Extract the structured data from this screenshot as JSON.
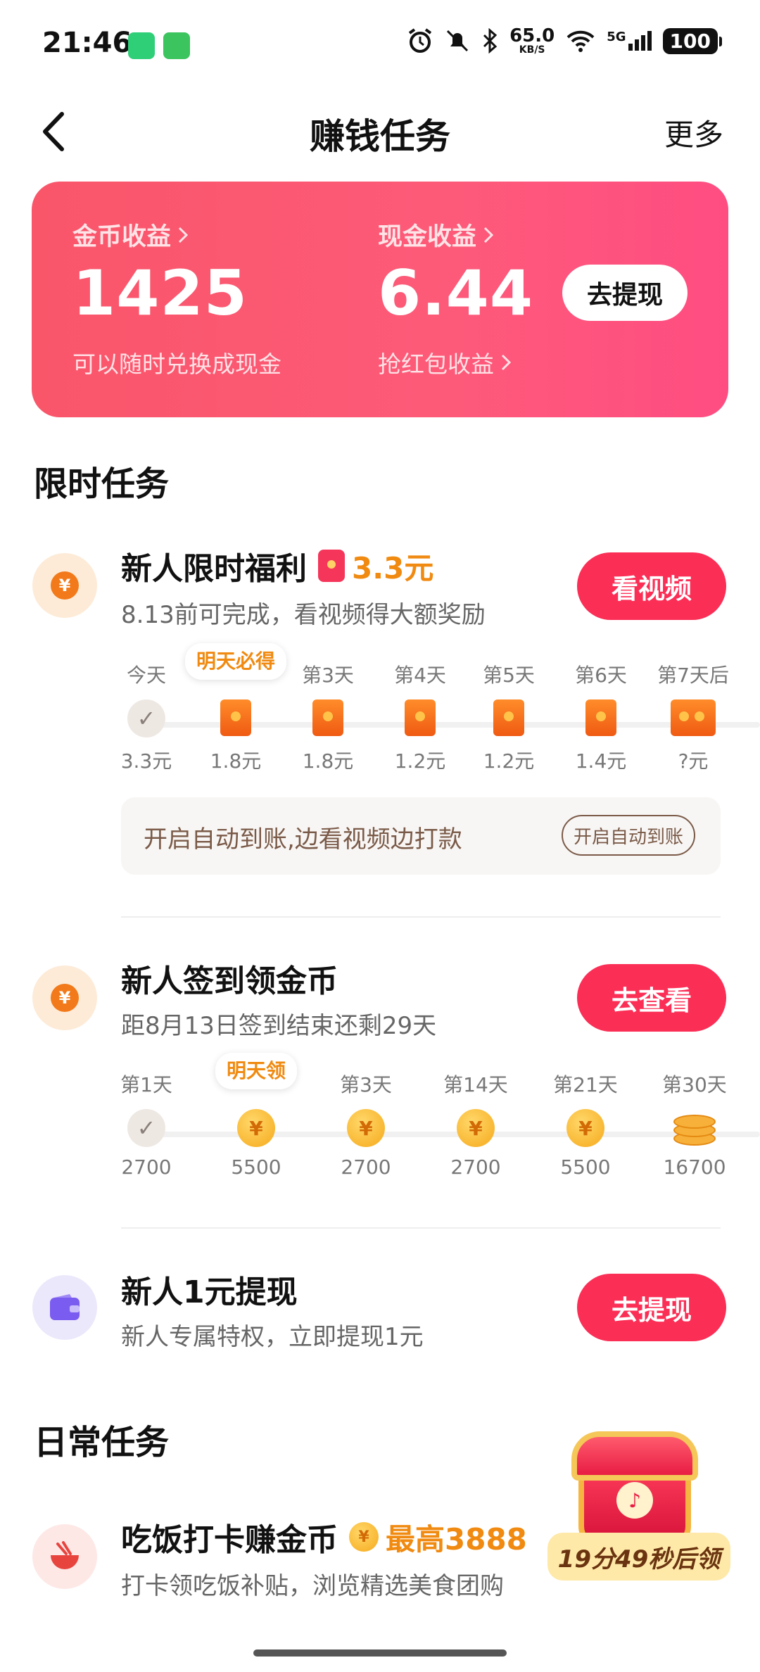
{
  "status": {
    "time": "21:46",
    "speed_value": "65.0",
    "speed_unit": "KB/S",
    "network": "5G",
    "battery": "100"
  },
  "nav": {
    "title": "赚钱任务",
    "more": "更多"
  },
  "earnings": {
    "coin_label": "金币收益",
    "coin_value": "1425",
    "coin_sub": "可以随时兑换成现金",
    "cash_label": "现金收益",
    "cash_value": "6.44",
    "cash_sub": "抢红包收益",
    "withdraw_button": "去提现"
  },
  "sections": {
    "limited": "限时任务",
    "daily": "日常任务"
  },
  "task1": {
    "title": "新人限时福利",
    "reward": "3.3元",
    "desc": "8.13前可完成，看视频得大额奖励",
    "button": "看视频",
    "tomorrow_tag": "明天必得",
    "days": [
      {
        "day": "今天",
        "value": "3.3元",
        "state": "done"
      },
      {
        "day": "明天",
        "value": "1.8元",
        "state": "tomorrow"
      },
      {
        "day": "第3天",
        "value": "1.8元",
        "state": "locked"
      },
      {
        "day": "第4天",
        "value": "1.2元",
        "state": "locked"
      },
      {
        "day": "第5天",
        "value": "1.2元",
        "state": "locked"
      },
      {
        "day": "第6天",
        "value": "1.4元",
        "state": "locked"
      },
      {
        "day": "第7天后",
        "value": "?元",
        "state": "locked"
      }
    ],
    "auto_text": "开启自动到账,边看视频边打款",
    "auto_button": "开启自动到账"
  },
  "task2": {
    "title": "新人签到领金币",
    "desc": "距8月13日签到结束还剩29天",
    "button": "去查看",
    "tomorrow_tag": "明天领",
    "days": [
      {
        "day": "第1天",
        "value": "2700",
        "state": "done"
      },
      {
        "day": "明天",
        "value": "5500",
        "state": "tomorrow"
      },
      {
        "day": "第3天",
        "value": "2700",
        "state": "locked"
      },
      {
        "day": "第14天",
        "value": "2700",
        "state": "locked"
      },
      {
        "day": "第21天",
        "value": "5500",
        "state": "locked"
      },
      {
        "day": "第30天",
        "value": "16700",
        "state": "locked"
      }
    ]
  },
  "task3": {
    "title": "新人1元提现",
    "desc": "新人专属特权，立即提现1元",
    "button": "去提现"
  },
  "task4": {
    "title": "吃饭打卡赚金币",
    "reward": "最高3888",
    "desc": "打卡领吃饭补贴，浏览精选美食团购"
  },
  "chest": {
    "countdown": "19分49秒后领",
    "logo": "♪"
  },
  "colors": {
    "accent": "#fb2e56",
    "card": "#fd5a79",
    "orange": "#f08a10"
  }
}
